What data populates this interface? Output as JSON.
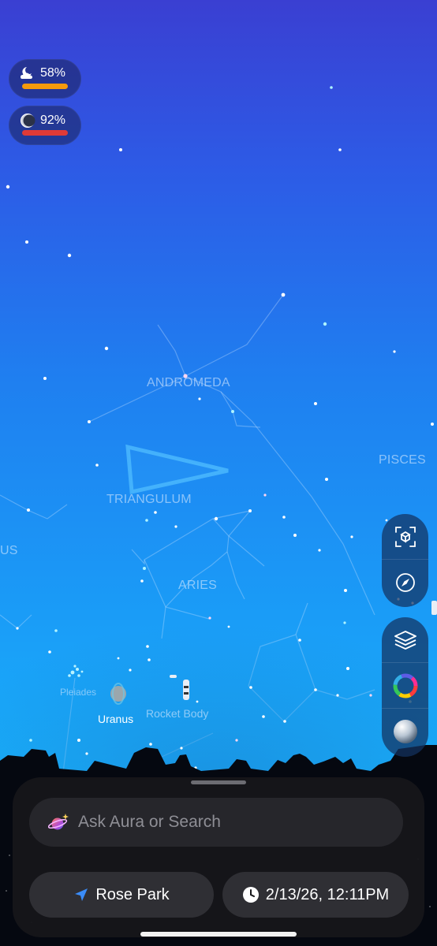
{
  "status": {
    "cloud_cover": {
      "icon": "cloud-moon-icon",
      "value": "58%",
      "level": 0.58,
      "bar_color": "#f59a0c"
    },
    "moon_brightness": {
      "icon": "moon-phase-icon",
      "value": "92%",
      "level": 0.92,
      "bar_color": "#e03a37"
    }
  },
  "sky": {
    "constellations": [
      "ANDROMEDA",
      "TRIANGULUM",
      "PISCES",
      "ARIES",
      "US"
    ],
    "objects": [
      "Pleiades",
      "Uranus",
      "Rocket Body"
    ]
  },
  "toolbar": {
    "top_group": [
      {
        "icon": "recenter-ar-icon"
      },
      {
        "icon": "compass-icon"
      }
    ],
    "bottom_group": [
      {
        "icon": "layers-icon"
      },
      {
        "icon": "color-wheel-icon"
      },
      {
        "icon": "sky-sphere-icon"
      }
    ]
  },
  "bottom_sheet": {
    "search": {
      "icon": "aura-planet-icon",
      "placeholder": "Ask Aura or Search"
    },
    "location": {
      "icon": "location-arrow-icon",
      "label": "Rose Park"
    },
    "datetime": {
      "icon": "clock-icon",
      "label": "2/13/26, 12:11PM"
    }
  },
  "colors": {
    "accent": "#3a8cf8",
    "sheet": "#161619"
  }
}
